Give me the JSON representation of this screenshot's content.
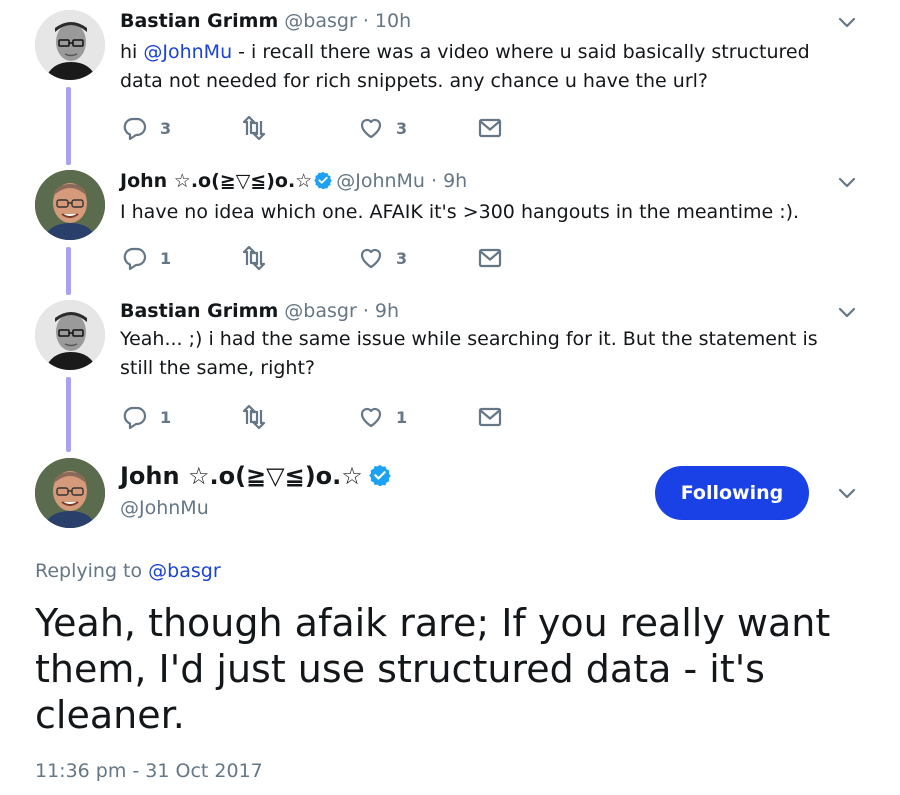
{
  "tweets": [
    {
      "name": "Bastian Grimm",
      "handle": "@basgr",
      "time": "· 10h",
      "verified": false,
      "text_before": "hi ",
      "mention": "@JohnMu",
      "text_after": " - i recall there was a video where u said basically structured data not needed for rich snippets. any chance u have the url?",
      "replies": "3",
      "retweets": "",
      "likes": "3"
    },
    {
      "name": "John ☆.o(≧▽≦)o.☆",
      "handle": "@JohnMu",
      "time": "· 9h",
      "verified": true,
      "text": "I have no idea which one. AFAIK it's >300 hangouts in the meantime :).",
      "replies": "1",
      "retweets": "",
      "likes": "3"
    },
    {
      "name": "Bastian Grimm",
      "handle": "@basgr",
      "time": "· 9h",
      "verified": false,
      "text": "Yeah... ;) i had the same issue while searching for it.  But the statement is still the same, right?",
      "replies": "1",
      "retweets": "",
      "likes": "1"
    }
  ],
  "main_tweet": {
    "name": "John ☆.o(≧▽≦)o.☆",
    "handle": "@JohnMu",
    "follow_label": "Following",
    "replying_prefix": "Replying to ",
    "replying_to": "@basgr",
    "text": "Yeah, though afaik rare; If you really want them, I'd just use structured data - it's cleaner.",
    "timestamp": "11:36 pm - 31 Oct 2017"
  },
  "icons": {
    "reply": "reply-icon",
    "retweet": "retweet-icon",
    "like": "heart-icon",
    "message": "envelope-icon",
    "more": "chevron-down-icon",
    "verified": "verified-badge-icon"
  },
  "colors": {
    "link": "#1b43d8",
    "button": "#1a41e6",
    "thread": "#a9a2f2",
    "muted": "#657786"
  }
}
